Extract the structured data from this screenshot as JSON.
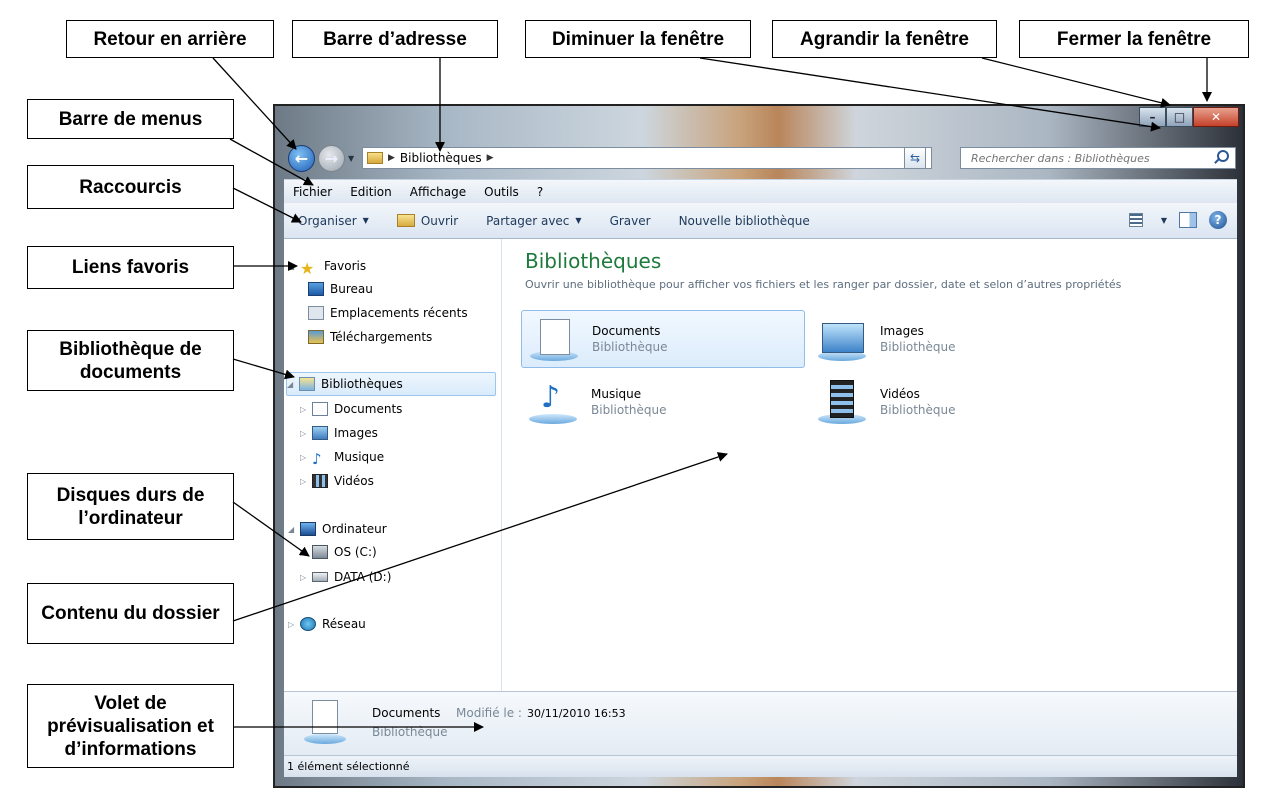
{
  "callouts": {
    "retour": "Retour en arrière",
    "adresse": "Barre d’adresse",
    "diminuer": "Diminuer la fenêtre",
    "agrandir": "Agrandir la fenêtre",
    "fermer": "Fermer la fenêtre",
    "menus": "Barre de menus",
    "raccourcis": "Raccourcis",
    "liens_favoris": "Liens favoris",
    "bibliotheque_documents": "Bibliothèque de documents",
    "disques": "Disques durs de l’ordinateur",
    "contenu": "Contenu du dossier",
    "volet": "Volet de prévisualisation et d’informations"
  },
  "window": {
    "controls": {
      "minimize": "–",
      "maximize": "□",
      "close": "✕"
    },
    "address": {
      "path": "Bibliothèques",
      "search_placeholder": "Rechercher dans : Bibliothèques"
    },
    "menu": [
      "Fichier",
      "Edition",
      "Affichage",
      "Outils",
      "?"
    ],
    "toolbar": {
      "organiser": "Organiser",
      "ouvrir": "Ouvrir",
      "partager": "Partager avec",
      "graver": "Graver",
      "nouvelle": "Nouvelle bibliothèque"
    },
    "nav": {
      "favoris": "Favoris",
      "bureau": "Bureau",
      "emplacements": "Emplacements récents",
      "telechargements": "Téléchargements",
      "bibliotheques": "Bibliothèques",
      "documents": "Documents",
      "images": "Images",
      "musique": "Musique",
      "videos": "Vidéos",
      "ordinateur": "Ordinateur",
      "os": "OS (C:)",
      "data": "DATA (D:)",
      "reseau": "Réseau"
    },
    "content": {
      "title": "Bibliothèques",
      "subtitle": "Ouvrir une bibliothèque pour afficher vos fichiers et les ranger par dossier, date et selon d’autres propriétés",
      "libraries": [
        {
          "name": "Documents",
          "type": "Bibliothèque"
        },
        {
          "name": "Images",
          "type": "Bibliothèque"
        },
        {
          "name": "Musique",
          "type": "Bibliothèque"
        },
        {
          "name": "Vidéos",
          "type": "Bibliothèque"
        }
      ]
    },
    "details": {
      "name": "Documents",
      "modified_label": "Modifié le :",
      "modified_value": "30/11/2010 16:53",
      "type": "Bibliothèque"
    },
    "status": "1 élément sélectionné"
  }
}
